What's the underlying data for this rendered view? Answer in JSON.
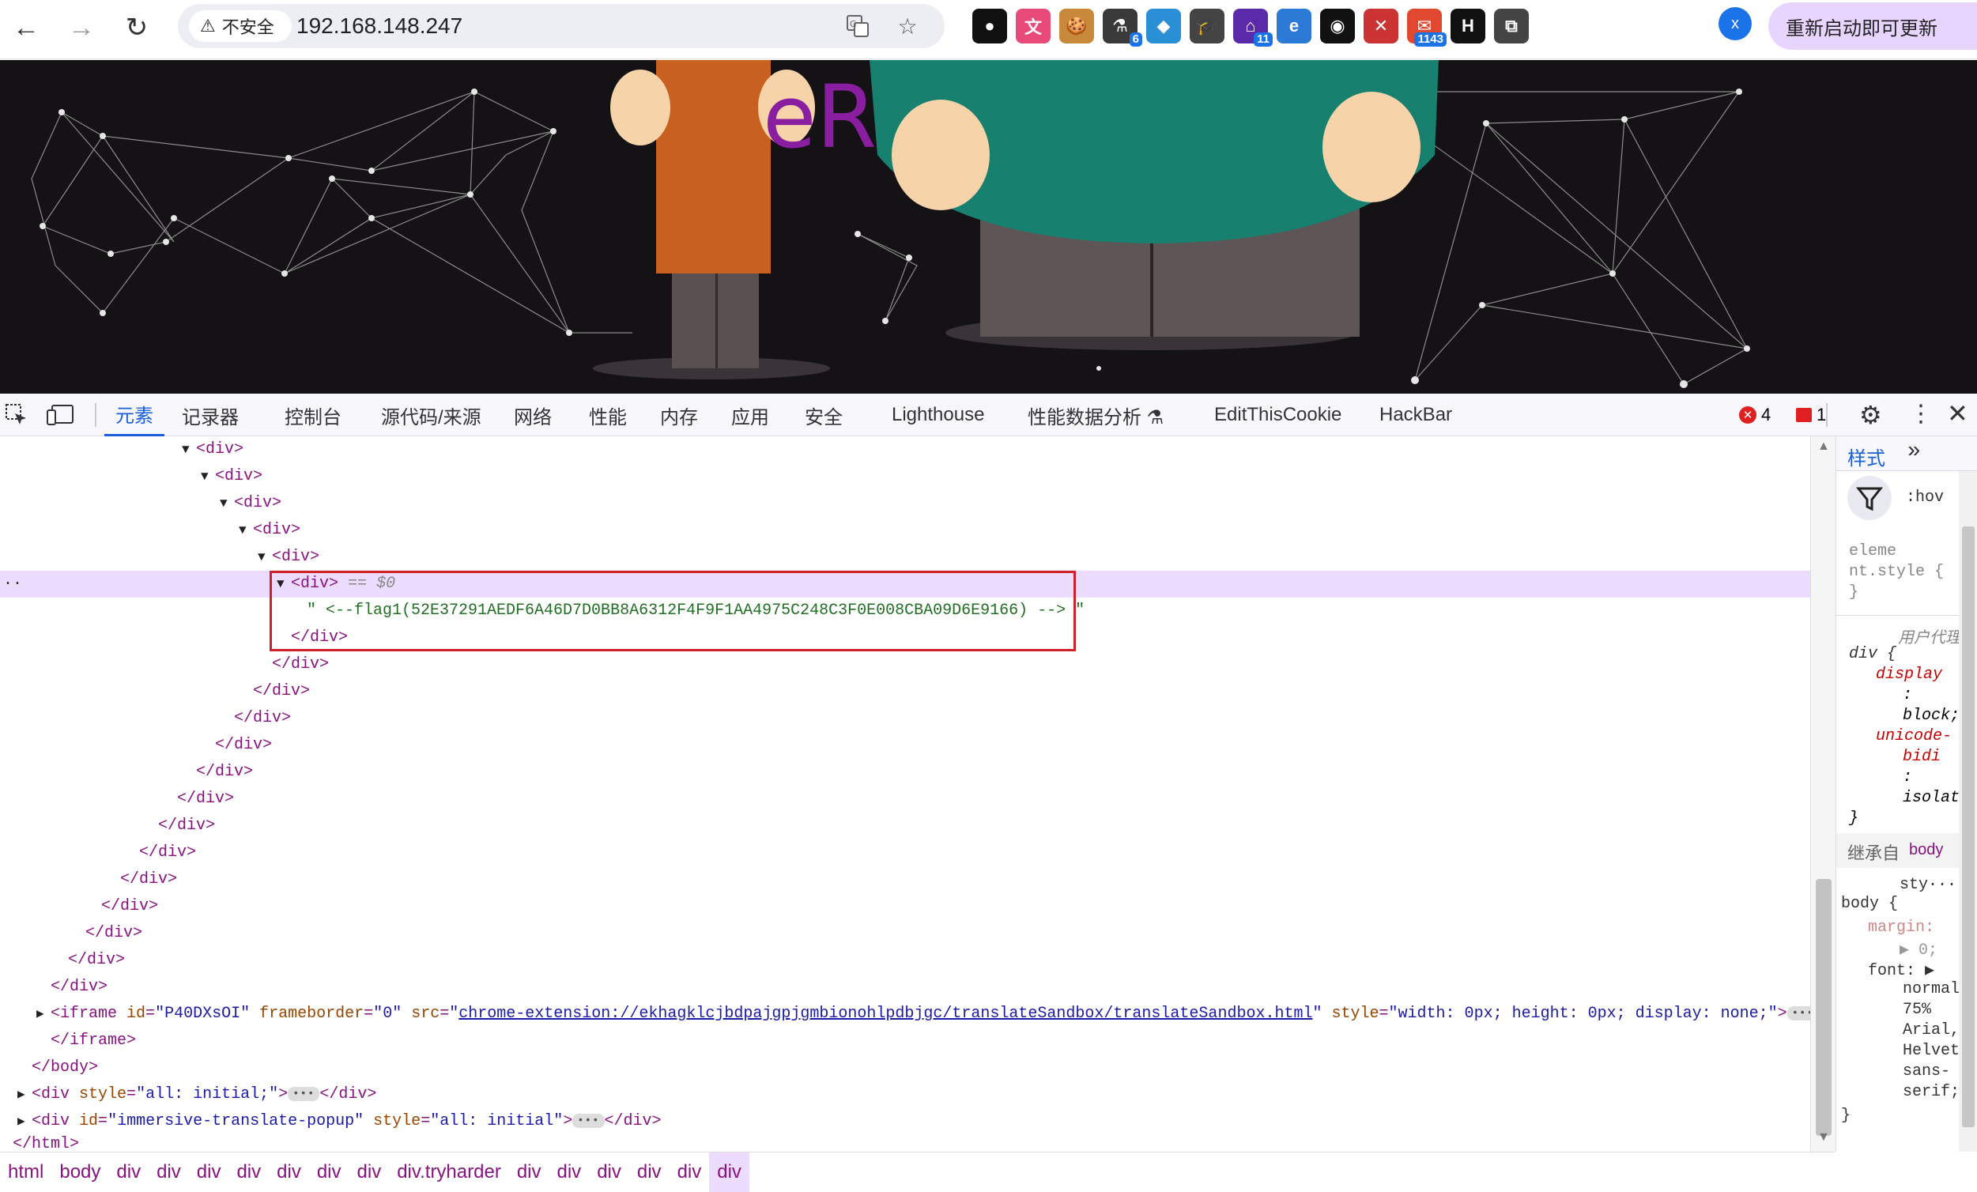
{
  "browser": {
    "security_label": "不安全",
    "url": "192.168.148.247",
    "update_button": "重新启动即可更新",
    "avatar_letter": "x",
    "extensions": [
      {
        "name": "record-icon",
        "color": "#111111",
        "glyph": "●"
      },
      {
        "name": "translate-extension-icon",
        "color": "#e84a7a",
        "glyph": "文"
      },
      {
        "name": "cookie-icon",
        "color": "#c88a3a",
        "glyph": "🍪"
      },
      {
        "name": "extension-6-icon",
        "color": "#3a3a3a",
        "glyph": "⚗",
        "badge": "6"
      },
      {
        "name": "shield-ext-icon",
        "color": "#2b8fd6",
        "glyph": "◆"
      },
      {
        "name": "graduation-cap-icon",
        "color": "#444444",
        "glyph": "🎓"
      },
      {
        "name": "extension-11-icon",
        "color": "#5b2aa8",
        "glyph": "⌂",
        "badge": "11"
      },
      {
        "name": "ie-icon",
        "color": "#2b7ad6",
        "glyph": "e"
      },
      {
        "name": "mask-icon",
        "color": "#111111",
        "glyph": "◉"
      },
      {
        "name": "close-red-ext-icon",
        "color": "#cc3333",
        "glyph": "✕"
      },
      {
        "name": "mail-ext-icon",
        "color": "#e0492f",
        "glyph": "✉",
        "badge": "1143"
      },
      {
        "name": "hackbar-icon",
        "color": "#111111",
        "glyph": "H"
      },
      {
        "name": "puzzle-icon",
        "color": "#444444",
        "glyph": "⧉"
      }
    ]
  },
  "page": {
    "partial_text": "eR"
  },
  "devtools": {
    "tabs": [
      "元素",
      "记录器",
      "控制台",
      "源代码/来源",
      "网络",
      "性能",
      "内存",
      "应用",
      "安全",
      "Lighthouse",
      "性能数据分析 ⚗",
      "EditThisCookie",
      "HackBar"
    ],
    "error_count": "4",
    "warning_count": "1",
    "dom": {
      "div": "div",
      "selected_marker": "== $0",
      "comment_text": "\" <--flag1(52E37291AEDF6A46D7D0BB8A6312F4F9F1AA4975C248C3F0E008CBA09D6E9166) --> \"",
      "iframe_id": "P40DXsOI",
      "iframe_frameborder": "0",
      "iframe_src": "chrome-extension://ekhagklcjbdpajgpjgmbionohlpdbjgc/translateSandbox/translateSandbox.html",
      "iframe_style": "width: 0px; height: 0px; display: none;",
      "body": "body",
      "html": "html",
      "div_style_all": "all: initial;",
      "popup_id": "immersive-translate-popup",
      "popup_style": "all: initial"
    },
    "styles_panel": {
      "tab_label": "样式",
      "hov_label": ":hov",
      "element_style_1": "eleme",
      "element_style_2": "nt.style {",
      "close_brace": "}",
      "ua_label": "用户代理",
      "div_selector": "div {",
      "prop_display": "display",
      "colon": ":",
      "val_block": "block;",
      "prop_unicode": "unicode-",
      "prop_bidi": "bidi",
      "val_isolate": "isolat",
      "inherit_label": "继承自",
      "inherit_from": "body",
      "sty_label": "sty···",
      "body_selector": "body {",
      "prop_margin": "margin:",
      "val_margin": "▶ 0;",
      "prop_font": "font:",
      "font_vals": [
        "normal",
        "75%",
        "Arial,",
        "Helvet",
        "sans-",
        "serif;"
      ]
    },
    "breadcrumbs": [
      "html",
      "body",
      "div",
      "div",
      "div",
      "div",
      "div",
      "div",
      "div",
      "div.tryharder",
      "div",
      "div",
      "div",
      "div",
      "div",
      "div"
    ]
  }
}
